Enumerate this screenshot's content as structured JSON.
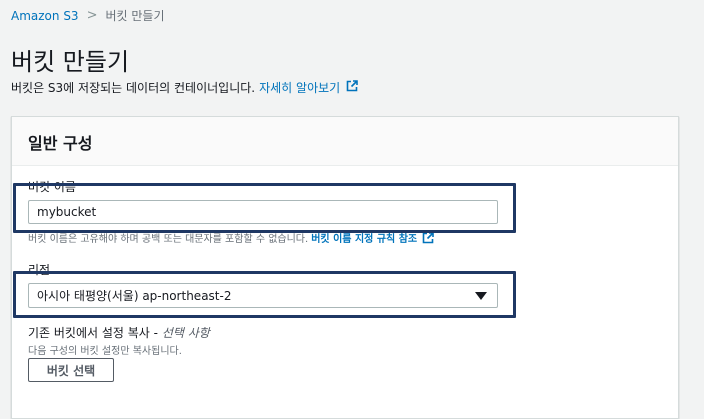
{
  "breadcrumb": {
    "root": "Amazon S3",
    "separator": ">",
    "current": "버킷 만들기"
  },
  "page": {
    "title": "버킷 만들기",
    "description": "버킷은 S3에 저장되는 데이터의 컨테이너입니다.",
    "learn_more": "자세히 알아보기"
  },
  "panel": {
    "title": "일반 구성",
    "bucket_name": {
      "label": "버킷 이름",
      "value": "mybucket",
      "hint": "버킷 이름은 고유해야 하며 공백 또는 대문자를 포함할 수 없습니다.",
      "hint_link": "버킷 이름 지정 규칙 참조"
    },
    "region": {
      "label": "리전",
      "value": "아시아 태평양(서울) ap-northeast-2"
    },
    "copy_settings": {
      "title": "기존 버킷에서 설정 복사 -",
      "optional": "선택 사항",
      "description": "다음 구성의 버킷 설정만 복사됩니다.",
      "button": "버킷 선택"
    }
  },
  "colors": {
    "link": "#0073bb",
    "highlight_box": "#1f3864",
    "background": "#f2f3f3"
  },
  "icons": {
    "external_link": "external-link-icon",
    "dropdown": "caret-down-icon"
  }
}
